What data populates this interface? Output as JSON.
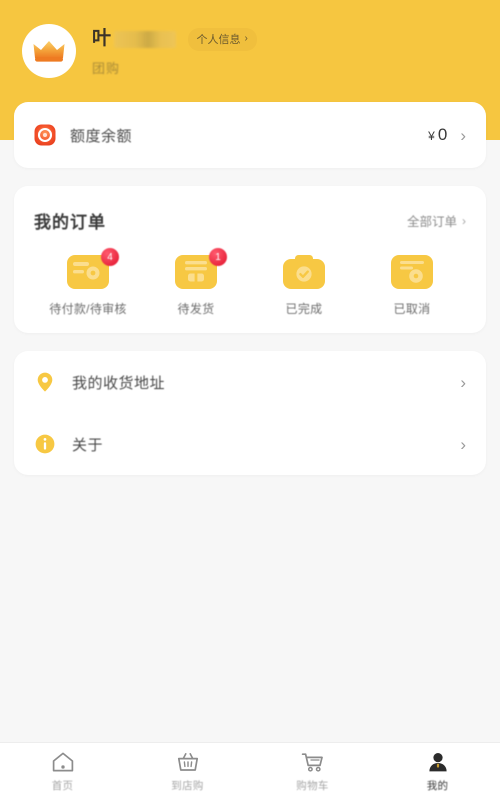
{
  "theme": {
    "header_yellow": "#F6C640",
    "page_bg": "#F7F7F7",
    "card_white": "#FFFFFF",
    "icon_yellow": "#F7C843",
    "badge_red": "#E8243C",
    "balance_icon_red": "#F04A2A",
    "text_dark": "#3B3B3B",
    "text_muted": "#8D8D8D",
    "tab_active": "#3B3B3B",
    "tab_inactive": "#A6A6A6"
  },
  "header": {
    "avatar_icon": "crown-icon",
    "username": "叶",
    "username_redacted": true,
    "info_chip": {
      "label": "个人信息",
      "chevron": "›"
    },
    "subtitle": "团购"
  },
  "balance": {
    "icon": "credit-coin-icon",
    "label": "额度余额",
    "currency": "¥",
    "amount": "0",
    "chevron": "›"
  },
  "orders": {
    "title": "我的订单",
    "all_link": {
      "label": "全部订单",
      "chevron": "›"
    },
    "items": [
      {
        "label": "待付款/待审核",
        "icon": "wallet-pay-icon",
        "badge": "4"
      },
      {
        "label": "待发货",
        "icon": "package-ship-icon",
        "badge": "1"
      },
      {
        "label": "已完成",
        "icon": "box-done-icon",
        "badge": ""
      },
      {
        "label": "已取消",
        "icon": "box-cancel-icon",
        "badge": ""
      }
    ]
  },
  "menu": {
    "items": [
      {
        "label": "我的收货地址",
        "icon": "location-pin-icon",
        "chevron": "›"
      },
      {
        "label": "关于",
        "icon": "info-circle-icon",
        "chevron": "›"
      }
    ]
  },
  "tabbar": {
    "items": [
      {
        "label": "首页",
        "icon": "home-icon",
        "active": false
      },
      {
        "label": "到店购",
        "icon": "basket-icon",
        "active": false
      },
      {
        "label": "购物车",
        "icon": "cart-icon",
        "active": false
      },
      {
        "label": "我的",
        "icon": "person-icon",
        "active": true
      }
    ]
  }
}
